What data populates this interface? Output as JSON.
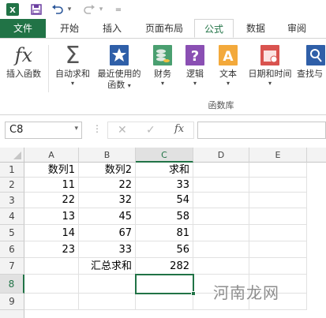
{
  "quick_access": {
    "save_icon": "save-icon",
    "undo_icon": "undo-icon",
    "redo_icon": "redo-icon"
  },
  "tabs": [
    "文件",
    "开始",
    "插入",
    "页面布局",
    "公式",
    "数据",
    "审阅"
  ],
  "ribbon": {
    "buttons": [
      {
        "label": "插入函数",
        "icon": "fx-icon"
      },
      {
        "label": "自动求和",
        "icon": "sigma-icon",
        "caret": "▾"
      },
      {
        "label": "最近使用的",
        "label2": "函数",
        "icon": "star-icon",
        "caret": "▾"
      },
      {
        "label": "财务",
        "icon": "finance-icon",
        "caret": "▾"
      },
      {
        "label": "逻辑",
        "icon": "logic-icon",
        "caret": "▾"
      },
      {
        "label": "文本",
        "icon": "text-icon",
        "caret": "▾"
      },
      {
        "label": "日期和时间",
        "icon": "calendar-icon",
        "caret": "▾"
      },
      {
        "label": "查找与",
        "icon": "lookup-icon"
      }
    ],
    "group_label": "函数库"
  },
  "formula_bar": {
    "name_box": "C8",
    "fx": "fx",
    "formula": ""
  },
  "grid": {
    "columns": [
      "A",
      "B",
      "C",
      "D",
      "E"
    ],
    "selected_column": "C",
    "rows": [
      "1",
      "2",
      "3",
      "4",
      "5",
      "6",
      "7",
      "8",
      "9"
    ],
    "selected_row": "8",
    "cells": [
      [
        "数列1",
        "数列2",
        "求和",
        "",
        ""
      ],
      [
        "11",
        "22",
        "33",
        "",
        ""
      ],
      [
        "22",
        "32",
        "54",
        "",
        ""
      ],
      [
        "13",
        "45",
        "58",
        "",
        ""
      ],
      [
        "14",
        "67",
        "81",
        "",
        ""
      ],
      [
        "23",
        "33",
        "56",
        "",
        ""
      ],
      [
        "",
        "汇总求和",
        "282",
        "",
        ""
      ],
      [
        "",
        "",
        "",
        "",
        ""
      ],
      [
        "",
        "",
        "",
        "",
        ""
      ]
    ]
  },
  "watermark": "河南龙网",
  "colors": {
    "accent": "#217346"
  }
}
